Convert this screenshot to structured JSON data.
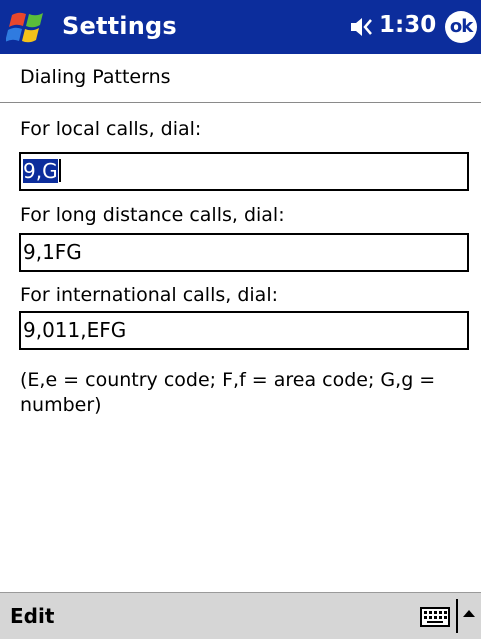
{
  "titlebar": {
    "title": "Settings",
    "time": "1:30",
    "ok_label": "ok"
  },
  "subheader": "Dialing Patterns",
  "fields": [
    {
      "label": "For local calls, dial:",
      "value": "9,G"
    },
    {
      "label": "For long distance calls, dial:",
      "value": "9,1FG"
    },
    {
      "label": "For international calls, dial:",
      "value": "9,011,EFG"
    }
  ],
  "note": "(E,e = country code; F,f = area code; G,g = number)",
  "bottombar": {
    "edit_label": "Edit"
  },
  "icons": {
    "start": "windows-flag-icon",
    "volume": "speaker-icon",
    "keyboard": "keyboard-icon",
    "sip": "up-arrow-icon"
  },
  "colors": {
    "titlebar": "#0c2d9c",
    "selection": "#0c2d9c",
    "bottombar": "#d6d6d6"
  }
}
